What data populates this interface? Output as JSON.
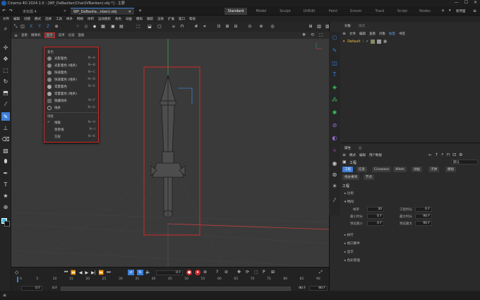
{
  "window": {
    "title": "Cinema 4D 2024.1.0 - [WP_DaBaolian(ChaiUVBanben).obj *] - 主要"
  },
  "tabs": {
    "doc1": "未标题 4",
    "doc2": "WP_DaBaolia...nben).obj",
    "add": "+"
  },
  "workspaces": [
    "Standard",
    "Model",
    "Sculpt",
    "UVEdit",
    "Paint",
    "Groom",
    "Track",
    "Script",
    "Nodes"
  ],
  "workspace_extra": "新界面",
  "menubar": [
    "文件",
    "编辑",
    "创建",
    "模式",
    "选择",
    "工具",
    "样条",
    "网格",
    "体积",
    "运动图形",
    "角色",
    "动画",
    "模拟",
    "跟踪",
    "渲染",
    "扩展",
    "窗口",
    "帮助"
  ],
  "toolbar": {
    "axis_x": "X",
    "axis_y": "Y",
    "axis_z": "Z"
  },
  "viewport_menu": [
    "查看",
    "摄像机",
    "显示",
    "选项",
    "过滤",
    "面板"
  ],
  "dropdown": {
    "section1": "着色",
    "items1": [
      {
        "label": "光影着色",
        "shortcut": "N~A"
      },
      {
        "label": "光影着色 (线条)",
        "shortcut": "N~B"
      },
      {
        "label": "快速着色",
        "shortcut": "N~C"
      },
      {
        "label": "快速着色 (线条)",
        "shortcut": "N~D"
      },
      {
        "label": "常量着色",
        "shortcut": "N~E"
      },
      {
        "label": "常量着色 (线条)",
        "shortcut": ""
      },
      {
        "label": "隐藏线条",
        "shortcut": "N~F"
      },
      {
        "label": "线条",
        "shortcut": "N~G"
      }
    ],
    "section2": "线框",
    "items2": [
      {
        "label": "线框",
        "shortcut": "N~H"
      },
      {
        "label": "等参线",
        "shortcut": "N~I"
      },
      {
        "label": "方形",
        "shortcut": "N~K"
      }
    ]
  },
  "timeline": {
    "current_frame": "0 F",
    "start": "0 F",
    "start2": "0 F",
    "end": "90 F",
    "end2": "90 F",
    "ticks": [
      "0",
      "5",
      "10",
      "15",
      "20",
      "25",
      "30",
      "35",
      "40",
      "45",
      "50",
      "55",
      "60",
      "65",
      "70",
      "75",
      "80",
      "85",
      "90"
    ]
  },
  "objects_panel": {
    "tabs": [
      "对象",
      "场次"
    ],
    "menu": [
      "文件",
      "编辑",
      "查看",
      "对象",
      "标签",
      "书签"
    ],
    "object_name": "Default"
  },
  "attributes_panel": {
    "tabs": [
      "属性",
      "层"
    ],
    "menu": [
      "模式",
      "编辑",
      "用户数据"
    ],
    "mode": "默认",
    "title": "工程",
    "subtabs": [
      "工程",
      "信息",
      "Cineware",
      "XRefs",
      "动画",
      "子弹",
      "模拟"
    ],
    "subtabs2": [
      "待办事项",
      "节点"
    ],
    "section_title": "工程",
    "sections": [
      "比例",
      "时间",
      "执行",
      "视口硬件",
      "显示",
      "色彩管理"
    ],
    "fields": {
      "fps_label": "帧率",
      "fps": "30",
      "time_label": "工程时长",
      "time": "0 F",
      "min_label": "最小时长",
      "min": "0 F",
      "max_label": "最大时长",
      "max": "90 F",
      "pmin_label": "预览最小",
      "pmin": "0 F",
      "pmax_label": "预览最大",
      "pmax": "90 F"
    }
  },
  "colors": {
    "accent_red": "#d12a2a",
    "accent_blue": "#3d7fd8",
    "bg": "#262626",
    "viewport": "#3a3a3a"
  }
}
